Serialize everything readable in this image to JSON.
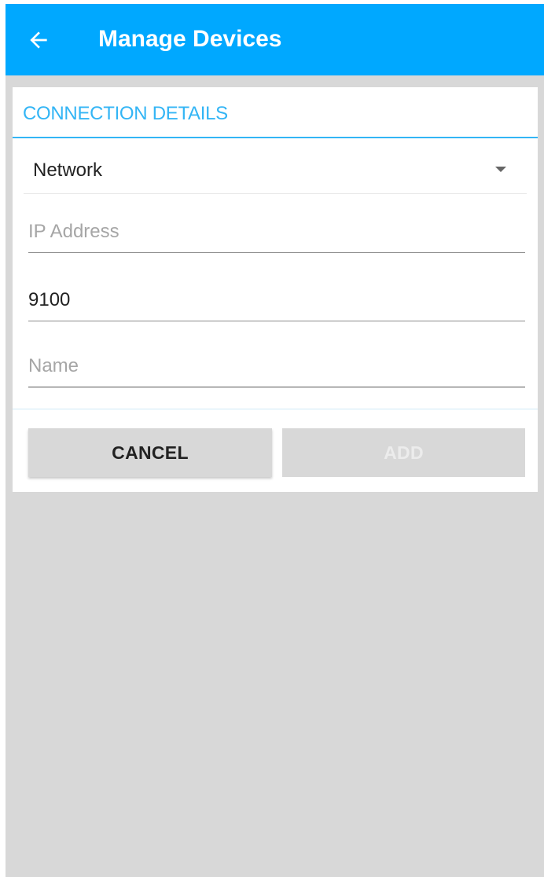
{
  "app_bar": {
    "title": "Manage Devices",
    "back_icon": "arrow-left-icon",
    "color": "#00a8ff"
  },
  "card": {
    "section_title": "CONNECTION DETAILS",
    "accent_color": "#33b5f5",
    "connection_type": {
      "selected": "Network",
      "icon": "dropdown-arrow-icon"
    },
    "fields": {
      "ip_address": {
        "value": "",
        "placeholder": "IP Address"
      },
      "port": {
        "value": "9100",
        "placeholder": ""
      },
      "name": {
        "value": "",
        "placeholder": "Name"
      }
    },
    "actions": {
      "cancel_label": "CANCEL",
      "add_label": "ADD",
      "add_enabled": false
    }
  },
  "background_color": "#d8d8d8"
}
